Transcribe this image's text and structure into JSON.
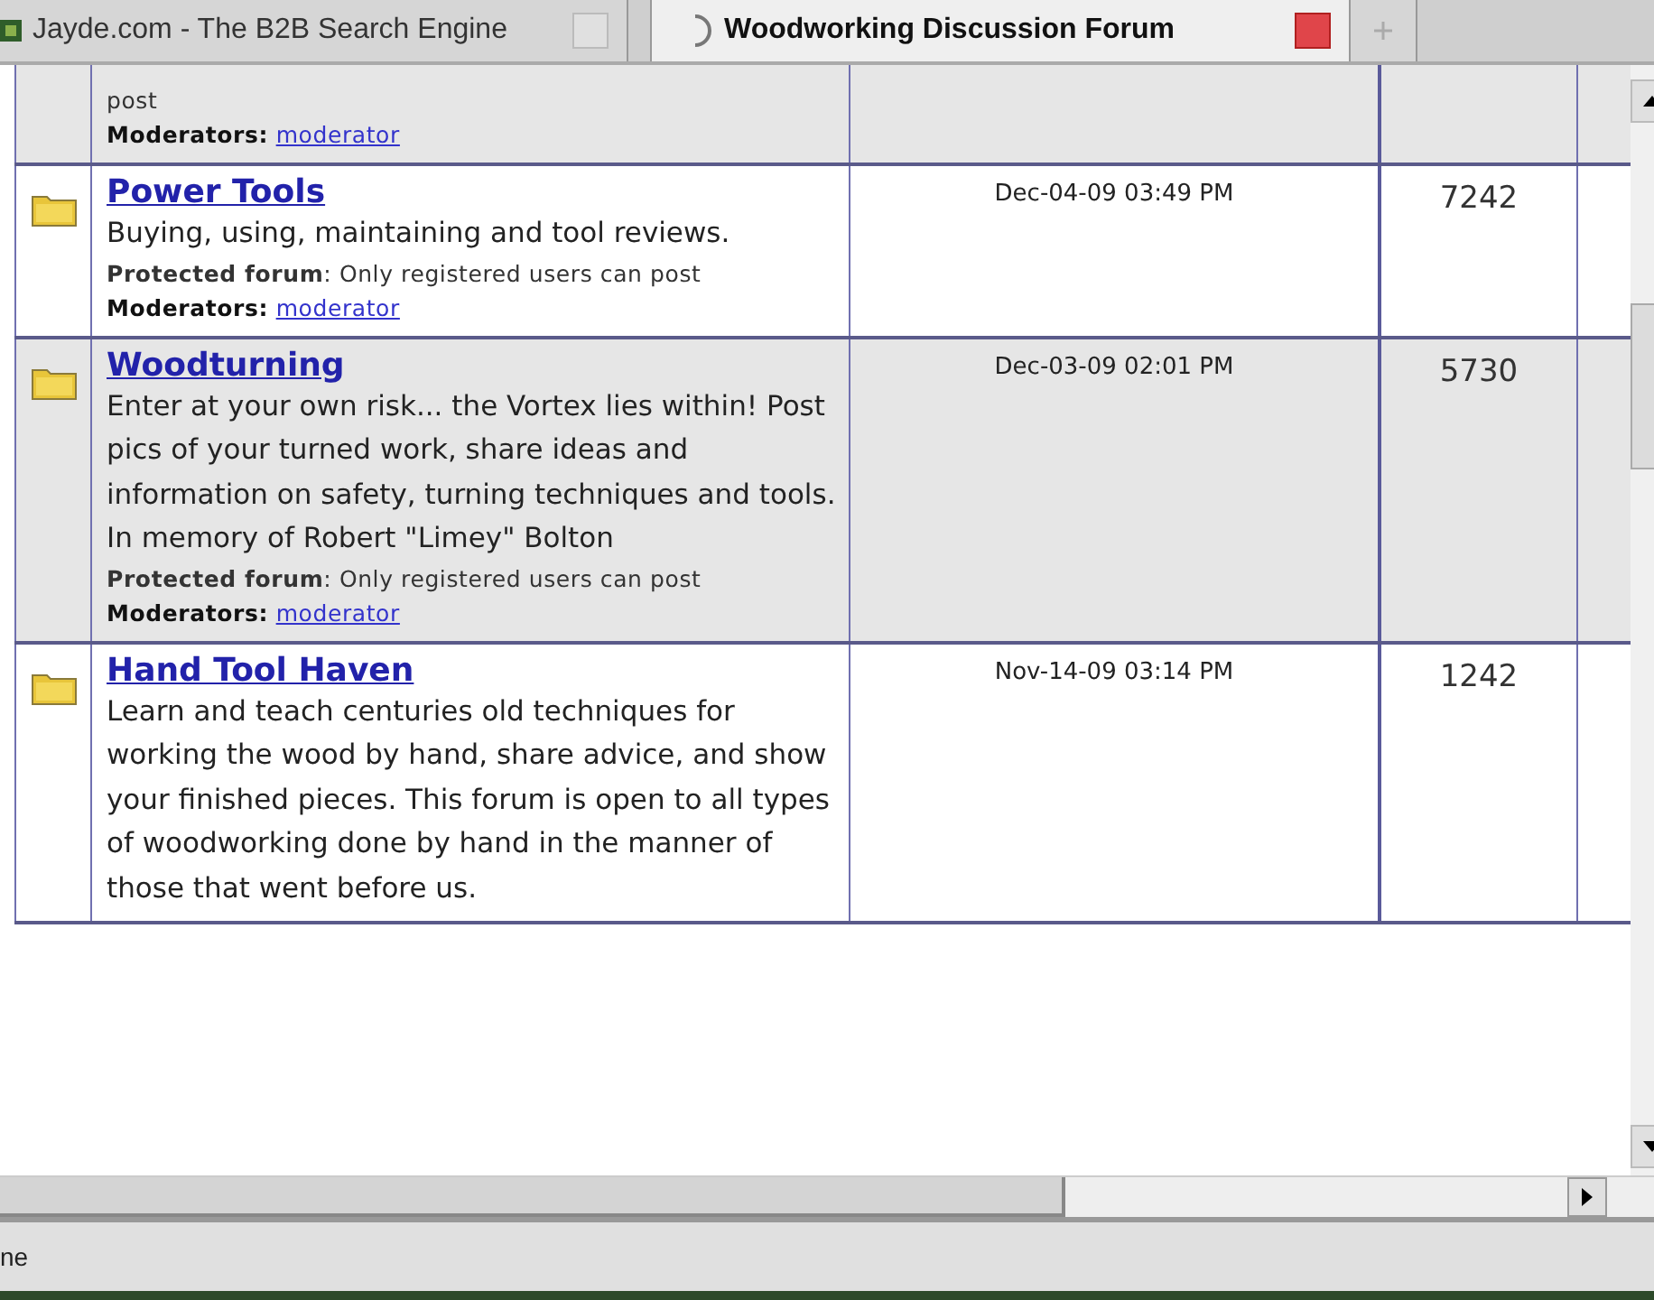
{
  "tabs": [
    {
      "title": "Jayde.com - The B2B Search Engine",
      "selected": false
    },
    {
      "title": "Woodworking Discussion Forum",
      "selected": true
    }
  ],
  "forums": [
    {
      "protected": "post",
      "moderators_label": "Moderators:",
      "moderator": "moderator"
    },
    {
      "title": "Power Tools",
      "description": [
        "Buying, using, maintaining and tool reviews."
      ],
      "protected": "**Protected forum**: Only registered users can post",
      "moderators_label": "Moderators:",
      "moderator": "moderator",
      "last_post": "Dec-04-09 03:49 PM",
      "posts": "7242"
    },
    {
      "title": "Woodturning",
      "description": [
        "Enter at your own risk... the Vortex lies within! Post pics of your turned work, share ideas and information on safety, turning techniques and tools.",
        "In memory of Robert \"Limey\" Bolton"
      ],
      "protected": "**Protected forum**: Only registered users can post",
      "moderators_label": "Moderators:",
      "moderator": "moderator",
      "last_post": "Dec-03-09 02:01 PM",
      "posts": "5730"
    },
    {
      "title": "Hand Tool Haven",
      "description": [
        "Learn and teach centuries old techniques for working the wood by hand, share advice, and show your finished pieces. This forum is open to all types of woodworking done by hand in the manner of those that went before us."
      ],
      "last_post": "Nov-14-09 03:14 PM",
      "posts": "1242"
    }
  ],
  "status_bar": "ne"
}
